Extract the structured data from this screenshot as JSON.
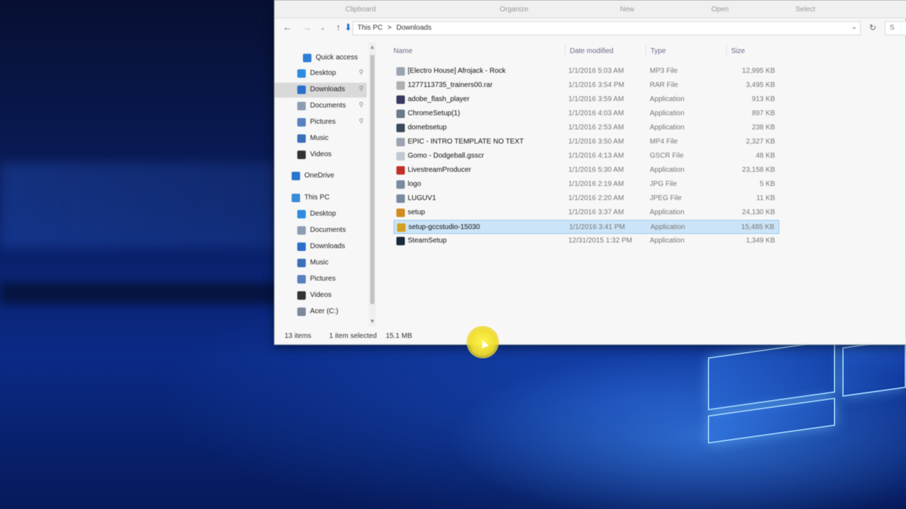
{
  "ribbon": {
    "groups": [
      "Clipboard",
      "Organize",
      "New",
      "Open",
      "Select"
    ]
  },
  "address": {
    "crumbs": [
      "This PC",
      ">",
      "Downloads"
    ],
    "dropdown_icon": "chevron-down-icon",
    "refresh_icon": "refresh-icon",
    "search_icon": "search-icon",
    "search_label": "S"
  },
  "nav": {
    "items": [
      {
        "label": "Quick access",
        "icon": "star-icon",
        "color": "#2e7fd6"
      },
      {
        "label": "Desktop",
        "icon": "desktop-icon",
        "color": "#2e8be0",
        "pinned": true
      },
      {
        "label": "Downloads",
        "icon": "download-icon",
        "color": "#2a6fc9",
        "pinned": true
      },
      {
        "label": "Documents",
        "icon": "documents-icon",
        "color": "#8a9db5",
        "pinned": true
      },
      {
        "label": "Pictures",
        "icon": "pictures-icon",
        "color": "#5a7fbf",
        "pinned": true
      },
      {
        "label": "Music",
        "icon": "music-icon",
        "color": "#3b6fb8"
      },
      {
        "label": "Videos",
        "icon": "videos-icon",
        "color": "#333333"
      },
      {
        "label": "OneDrive",
        "icon": "cloud-icon",
        "color": "#2a76cc"
      },
      {
        "label": "This PC",
        "icon": "pc-icon",
        "color": "#3a8ad8"
      },
      {
        "label": "Desktop",
        "icon": "desktop-icon",
        "color": "#2e8be0"
      },
      {
        "label": "Documents",
        "icon": "documents-icon",
        "color": "#8a9db5"
      },
      {
        "label": "Downloads",
        "icon": "download-icon",
        "color": "#2a6fc9"
      },
      {
        "label": "Music",
        "icon": "music-icon",
        "color": "#3b6fb8"
      },
      {
        "label": "Pictures",
        "icon": "pictures-icon",
        "color": "#5a7fbf"
      },
      {
        "label": "Videos",
        "icon": "videos-icon",
        "color": "#333333"
      },
      {
        "label": "Acer (C:)",
        "icon": "drive-icon",
        "color": "#7a8a9a"
      }
    ],
    "pin_glyph": "⚲"
  },
  "columns": {
    "name": "Name",
    "date": "Date modified",
    "type": "Type",
    "size": "Size"
  },
  "files": [
    {
      "name": "[Electro House] Afrojack - Rock",
      "date": "1/1/2016 5:03 AM",
      "type": "MP3 File",
      "size": "12,995 KB",
      "icon": "audio-file-icon",
      "color": "#9aa4b0"
    },
    {
      "name": "1277113735_trainers00.rar",
      "date": "1/1/2016 3:54 PM",
      "type": "RAR File",
      "size": "3,495 KB",
      "icon": "archive-icon",
      "color": "#b0b0b0"
    },
    {
      "name": "adobe_flash_player",
      "date": "1/1/2016 3:59 AM",
      "type": "Application",
      "size": "913 KB",
      "icon": "flash-icon",
      "color": "#3a3a60"
    },
    {
      "name": "ChromeSetup(1)",
      "date": "1/1/2016 4:03 AM",
      "type": "Application",
      "size": "897 KB",
      "icon": "chrome-icon",
      "color": "#6a7a8a"
    },
    {
      "name": "domebsetup",
      "date": "1/1/2016 2:53 AM",
      "type": "Application",
      "size": "238 KB",
      "icon": "app-icon",
      "color": "#3a4a5a"
    },
    {
      "name": "EPIC - INTRO TEMPLATE NO TEXT",
      "date": "1/1/2016 3:50 AM",
      "type": "MP4 File",
      "size": "2,327 KB",
      "icon": "video-file-icon",
      "color": "#9aa4b0"
    },
    {
      "name": "Gomo - Dodgeball.gsscr",
      "date": "1/1/2016 4:13 AM",
      "type": "GSCR File",
      "size": "48 KB",
      "icon": "file-icon",
      "color": "#c0c8d0"
    },
    {
      "name": "LivestreamProducer",
      "date": "1/1/2016 5:30 AM",
      "type": "Application",
      "size": "23,158 KB",
      "icon": "livestream-icon",
      "color": "#c0302a"
    },
    {
      "name": "logo",
      "date": "1/1/2016 2:19 AM",
      "type": "JPG File",
      "size": "5 KB",
      "icon": "image-file-icon",
      "color": "#7a8aa0"
    },
    {
      "name": "LUGUV1",
      "date": "1/1/2016 2:20 AM",
      "type": "JPEG File",
      "size": "11 KB",
      "icon": "image-file-icon",
      "color": "#7a8aa0"
    },
    {
      "name": "setup",
      "date": "1/1/2016 3:37 AM",
      "type": "Application",
      "size": "24,130 KB",
      "icon": "installer-icon",
      "color": "#d08a20"
    },
    {
      "name": "setup-gccstudio-15030",
      "date": "1/1/2016 3:41 PM",
      "type": "Application",
      "size": "15,485 KB",
      "icon": "installer-icon",
      "color": "#d4a020",
      "selected": true
    },
    {
      "name": "SteamSetup",
      "date": "12/31/2015 1:32 PM",
      "type": "Application",
      "size": "1,349 KB",
      "icon": "steam-icon",
      "color": "#1a2a3a"
    }
  ],
  "status": {
    "count": "13 items",
    "selected": "1 item selected",
    "size": "15.1 MB"
  },
  "colors": {
    "selection": "#cce4f7",
    "nav_selected": "#d9d9d9",
    "cursor_highlight": "#f5e63a"
  }
}
